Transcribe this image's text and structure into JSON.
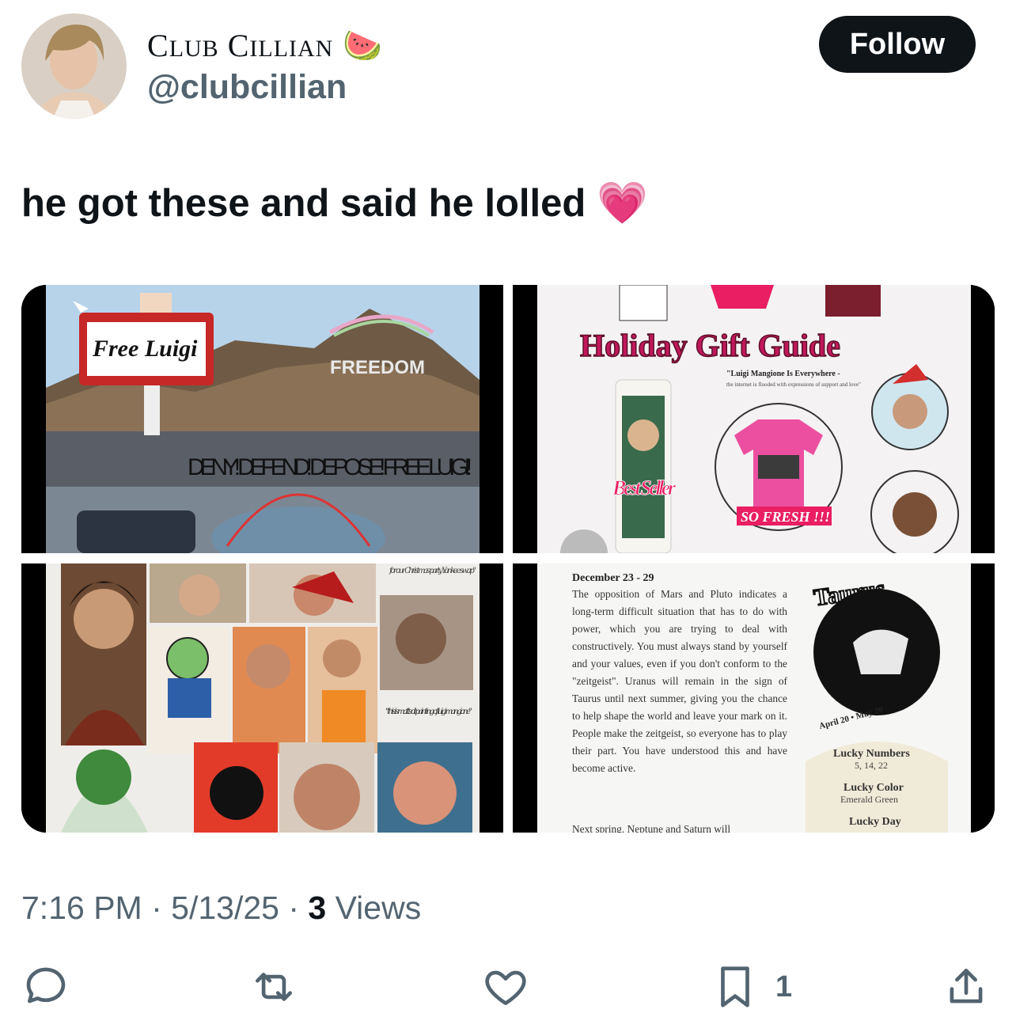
{
  "user": {
    "display_name_first_initial": "C",
    "display_name_first_rest": "lub",
    "display_name_last_initial": "C",
    "display_name_last_rest": "illian",
    "emoji": "🍉",
    "handle": "@clubcillian"
  },
  "follow_label": "Follow",
  "tweet": {
    "text": "he got these and said he lolled",
    "emoji": "💗"
  },
  "media": {
    "tile1": {
      "sign": "Free Luigi",
      "mountain_text": "FREEDOM",
      "banner": "DENY! DEFEND! DEPOSE! FREE LUIGI!"
    },
    "tile2": {
      "title": "Holiday Gift Guide",
      "subtitle": "\"Luigi Mangione Is Everywhere -",
      "small": "the internet is flooded with expressions of support and love\"",
      "candle": "Best Seller",
      "shirt_label": "SO FRESH !!!"
    },
    "tile3": {
      "note_top": "for our Christmas party Yankee swap\"",
      "note_bottom": "\"this is matt's oil painting of luigi mangione\""
    },
    "tile4": {
      "date": "December 23 - 29",
      "body": "The opposition of Mars and Pluto indicates a long-term difficult situation that has to do with power, which you are trying to deal with constructively. You must always stand by yourself and your values, even if you don't conform to the \"zeitgeist\". Uranus will remain in the sign of Taurus until next summer, giving you the chance to help shape the world and leave your mark on it. People make the zeitgeist, so everyone has to play their part. You have understood this and have become active.",
      "cut": "Next spring, Neptune and Saturn will",
      "sign": "Taurus",
      "range": "April 20 • May 20",
      "lucky_numbers_label": "Lucky Numbers",
      "lucky_numbers": "5, 14, 22",
      "lucky_color_label": "Lucky Color",
      "lucky_color": "Emerald Green",
      "lucky_day_label": "Lucky Day"
    }
  },
  "meta": {
    "time": "7:16 PM",
    "sep": " · ",
    "date": "5/13/25",
    "views_count": "3",
    "views_label": " Views"
  },
  "actions": {
    "bookmark_count": "1"
  },
  "icons": [
    "reply-icon",
    "retweet-icon",
    "like-icon",
    "bookmark-icon",
    "share-icon"
  ]
}
